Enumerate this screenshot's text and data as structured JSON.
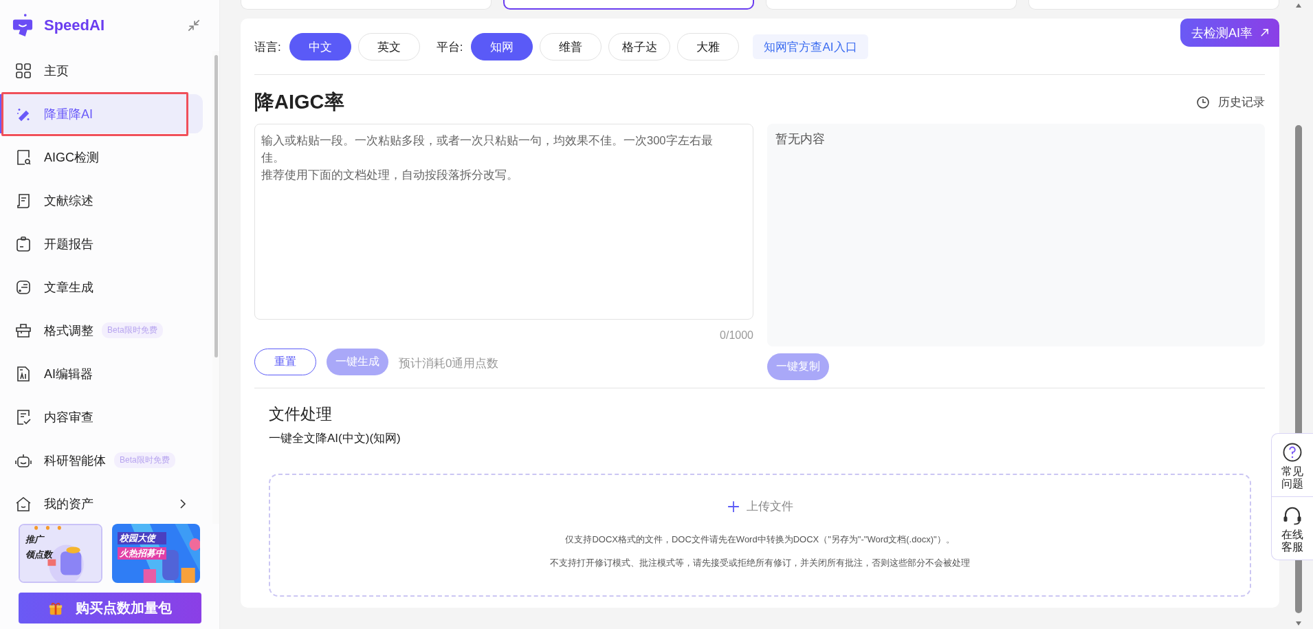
{
  "top_cards": [
    {
      "selected": false
    },
    {
      "selected": true
    },
    {
      "selected": false
    },
    {
      "selected": false
    }
  ],
  "sidebar": {
    "logo": "SpeedAI",
    "items": [
      {
        "label": "主页",
        "selected": false,
        "highlighted": false
      },
      {
        "label": "降重降AI",
        "selected": true,
        "highlighted": true
      },
      {
        "label": "AIGC检测",
        "selected": false,
        "highlighted": false
      },
      {
        "label": "文献综述",
        "selected": false,
        "highlighted": false
      },
      {
        "label": "开题报告",
        "selected": false,
        "highlighted": false
      },
      {
        "label": "文章生成",
        "selected": false,
        "highlighted": false
      },
      {
        "label": "格式调整",
        "selected": false,
        "highlighted": false,
        "badge": "Beta限时免费"
      },
      {
        "label": "AI编辑器",
        "selected": false,
        "highlighted": false
      },
      {
        "label": "内容审查",
        "selected": false,
        "highlighted": false
      },
      {
        "label": "科研智能体",
        "selected": false,
        "highlighted": false,
        "badge": "Beta限时免费"
      },
      {
        "label": "我的资产",
        "selected": false,
        "highlighted": false,
        "has_submenu": true
      }
    ],
    "banners": [
      {
        "lines": [
          "推广",
          "领点数"
        ]
      },
      {
        "lines": [
          "校园大使",
          "火热招募中"
        ]
      }
    ],
    "buy_button": "购买点数加量包"
  },
  "detect_badge": "去检测AI率",
  "lang_row": {
    "language_label": "语言:",
    "languages": [
      {
        "label": "中文",
        "selected": true
      },
      {
        "label": "英文",
        "selected": false
      }
    ],
    "platform_label": "平台:",
    "platforms": [
      {
        "label": "知网",
        "selected": true
      },
      {
        "label": "维普",
        "selected": false
      },
      {
        "label": "格子达",
        "selected": false
      },
      {
        "label": "大雅",
        "selected": false
      }
    ],
    "link": "知网官方查AI入口"
  },
  "title": "降AIGC率",
  "history": "历史记录",
  "input": {
    "placeholder_lines": [
      "输入或粘贴一段。一次粘贴多段，或者一次只粘贴一句，均效果不佳。一次300字左右最佳。",
      "推荐使用下面的文档处理，自动按段落拆分改写。"
    ],
    "counter": "0/1000"
  },
  "output": {
    "empty_text": "暂无内容"
  },
  "actions": [
    {
      "label": "重置",
      "kind": "outline",
      "disabled": false
    },
    {
      "label": "一键生成",
      "kind": "primary",
      "disabled": true
    }
  ],
  "cost_note": "预计消耗0通用点数",
  "copy_button": {
    "label": "一键复制",
    "disabled": true
  },
  "file": {
    "title": "文件处理",
    "subtitle": "一键全文降AI(中文)(知网)",
    "upload_label": "上传文件",
    "notes": [
      "仅支持DOCX格式的文件，DOC文件请先在Word中转换为DOCX（\"另存为\"-\"Word文档(.docx)\"）。",
      "不支持打开修订模式、批注模式等，请先接受或拒绝所有修订，并关闭所有批注，否则这些部分不会被处理"
    ]
  },
  "side_widget": [
    {
      "label": "常见问题"
    },
    {
      "label": "在线客服"
    }
  ]
}
